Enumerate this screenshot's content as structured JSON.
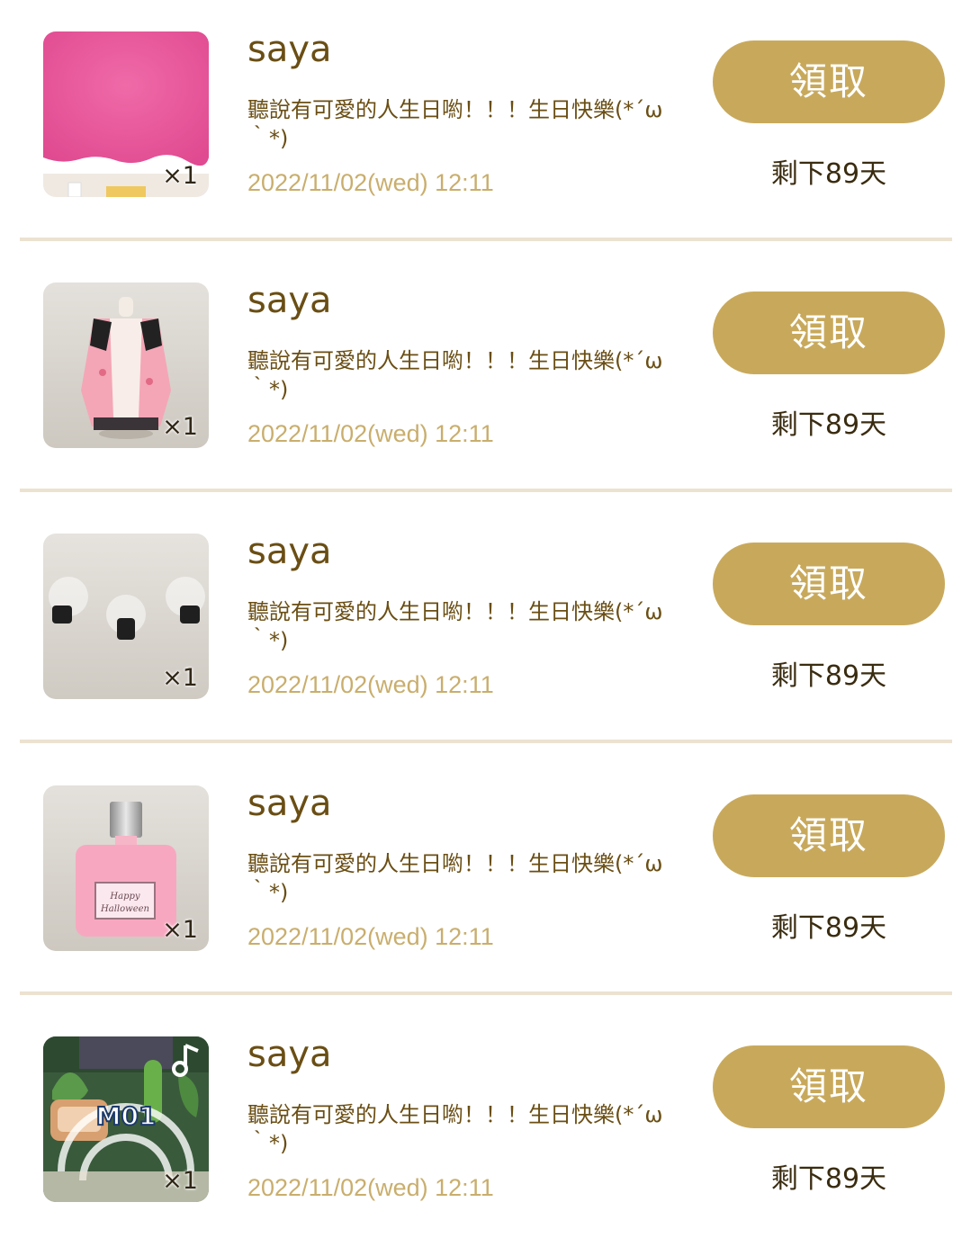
{
  "gifts": [
    {
      "sender": "saya",
      "message": "聽說有可愛的人生日喲！！！生日快樂(*´ω｀*)",
      "date": "2022/11/02(wed) 12:11",
      "claim_label": "領取",
      "remaining": "剩下89天",
      "quantity": "×1",
      "item_icon": "pink-fabric-icon"
    },
    {
      "sender": "saya",
      "message": "聽說有可愛的人生日喲！！！生日快樂(*´ω｀*)",
      "date": "2022/11/02(wed) 12:11",
      "claim_label": "領取",
      "remaining": "剩下89天",
      "quantity": "×1",
      "item_icon": "pink-jacket-icon"
    },
    {
      "sender": "saya",
      "message": "聽說有可愛的人生日喲！！！生日快樂(*´ω｀*)",
      "date": "2022/11/02(wed) 12:11",
      "claim_label": "領取",
      "remaining": "剩下89天",
      "quantity": "×1",
      "item_icon": "spotlights-icon"
    },
    {
      "sender": "saya",
      "message": "聽說有可愛的人生日喲！！！生日快樂(*´ω｀*)",
      "date": "2022/11/02(wed) 12:11",
      "claim_label": "領取",
      "remaining": "剩下89天",
      "quantity": "×1",
      "item_icon": "perfume-bottle-icon"
    },
    {
      "sender": "saya",
      "message": "聽說有可愛的人生日喲！！！生日快樂(*´ω｀*)",
      "date": "2022/11/02(wed) 12:11",
      "claim_label": "領取",
      "remaining": "剩下89天",
      "quantity": "×1",
      "item_icon": "music-track-icon",
      "item_label": "M01"
    }
  ],
  "colors": {
    "button": "#c8a95c",
    "text": "#6a4e14",
    "date": "#c9ae6d",
    "divider": "#ece2d0"
  }
}
